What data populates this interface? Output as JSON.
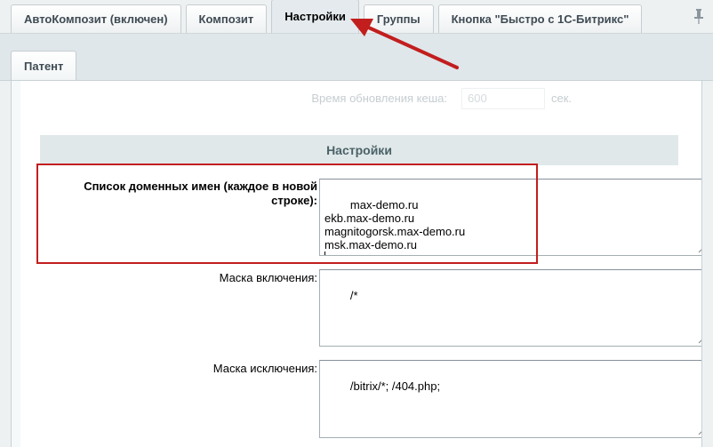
{
  "tabs_row1": [
    {
      "label": "АвтоКомпозит (включен)",
      "active": false
    },
    {
      "label": "Композит",
      "active": false
    },
    {
      "label": "Настройки",
      "active": true
    },
    {
      "label": "Группы",
      "active": false
    },
    {
      "label": "Кнопка \"Быстро с 1С-Битрикс\"",
      "active": false
    }
  ],
  "tabs_row2": [
    {
      "label": "Патент",
      "active": false
    }
  ],
  "cache_row": {
    "label": "Время обновления кеша:",
    "value": "600",
    "unit": "сек."
  },
  "section": {
    "title": "Настройки"
  },
  "fields": {
    "domains": {
      "label": "Список доменных имен (каждое в новой строке):",
      "value": "max-demo.ru\nekb.max-demo.ru\nmagnitogorsk.max-demo.ru\nmsk.max-demo.ru\n"
    },
    "include_mask": {
      "label": "Маска включения:",
      "value": "/*"
    },
    "exclude_mask": {
      "label": "Маска исключения:",
      "value": "/bitrix/*; /404.php;"
    }
  },
  "colors": {
    "highlight": "#c21e1e",
    "section_bg": "#e0e8ea"
  },
  "icons": {
    "pin": "pin-icon",
    "arrow": "red-arrow-annotation"
  }
}
